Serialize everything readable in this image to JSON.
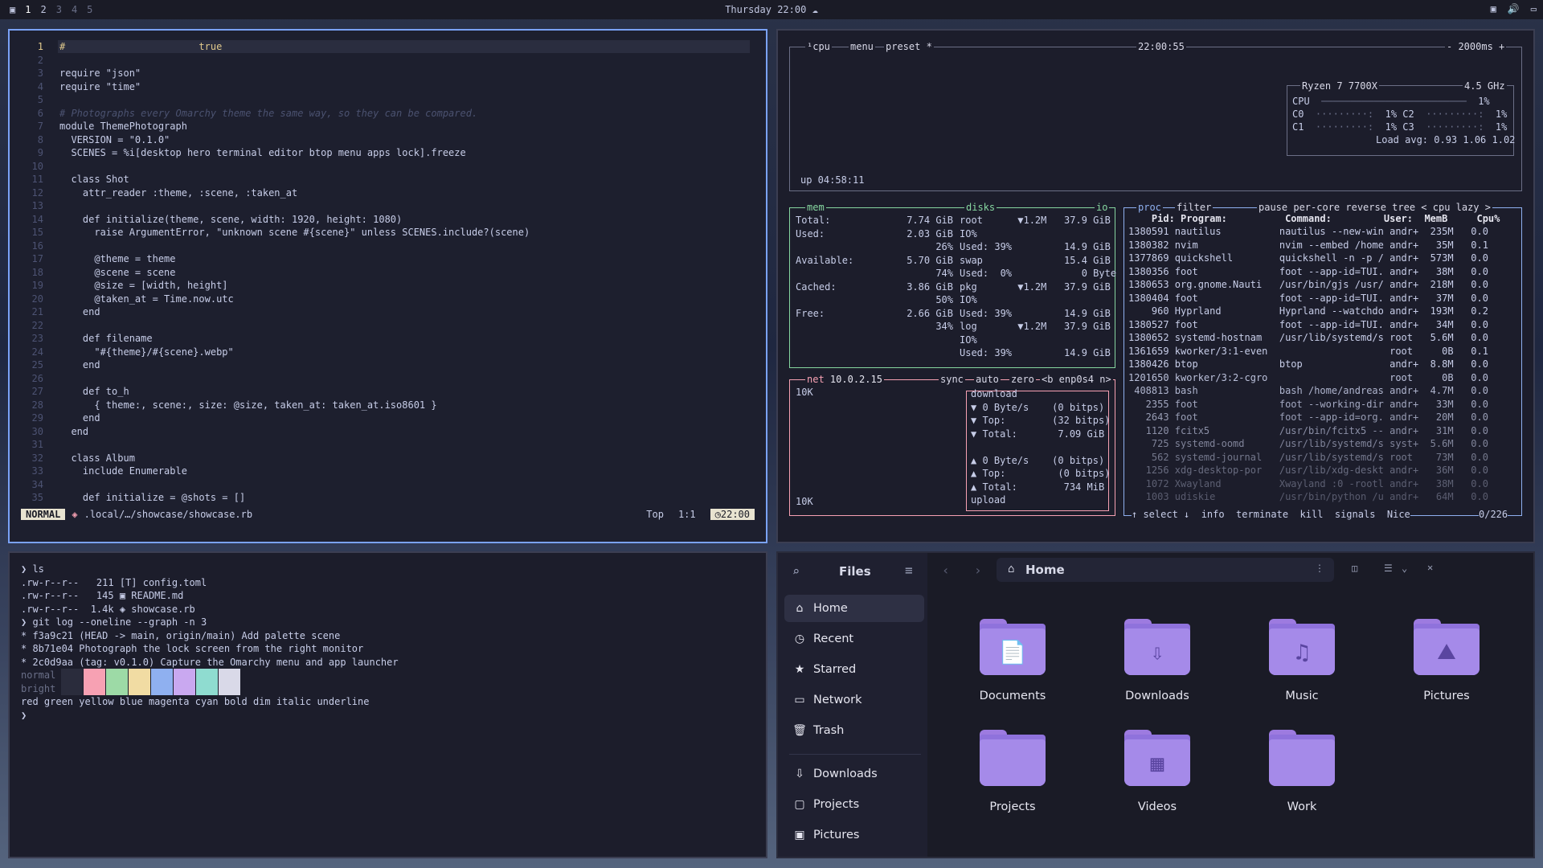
{
  "topbar": {
    "workspaces": [
      "1",
      "2",
      "3",
      "4",
      "5"
    ],
    "clock": "Thursday 22:00"
  },
  "nvim": {
    "lines": [
      {
        "n": "1",
        "t": "#                       true"
      },
      {
        "n": "2",
        "t": ""
      },
      {
        "n": "3",
        "t": "require \"json\""
      },
      {
        "n": "4",
        "t": "require \"time\""
      },
      {
        "n": "5",
        "t": ""
      },
      {
        "n": "6",
        "t": "# Photographs every Omarchy theme the same way, so they can be compared."
      },
      {
        "n": "7",
        "t": "module ThemePhotograph"
      },
      {
        "n": "8",
        "t": "  VERSION = \"0.1.0\""
      },
      {
        "n": "9",
        "t": "  SCENES = %i[desktop hero terminal editor btop menu apps lock].freeze"
      },
      {
        "n": "10",
        "t": ""
      },
      {
        "n": "11",
        "t": "  class Shot"
      },
      {
        "n": "12",
        "t": "    attr_reader :theme, :scene, :taken_at"
      },
      {
        "n": "13",
        "t": ""
      },
      {
        "n": "14",
        "t": "    def initialize(theme, scene, width: 1920, height: 1080)"
      },
      {
        "n": "15",
        "t": "      raise ArgumentError, \"unknown scene #{scene}\" unless SCENES.include?(scene)"
      },
      {
        "n": "16",
        "t": ""
      },
      {
        "n": "17",
        "t": "      @theme = theme"
      },
      {
        "n": "18",
        "t": "      @scene = scene"
      },
      {
        "n": "19",
        "t": "      @size = [width, height]"
      },
      {
        "n": "20",
        "t": "      @taken_at = Time.now.utc"
      },
      {
        "n": "21",
        "t": "    end"
      },
      {
        "n": "22",
        "t": ""
      },
      {
        "n": "23",
        "t": "    def filename"
      },
      {
        "n": "24",
        "t": "      \"#{theme}/#{scene}.webp\""
      },
      {
        "n": "25",
        "t": "    end"
      },
      {
        "n": "26",
        "t": ""
      },
      {
        "n": "27",
        "t": "    def to_h"
      },
      {
        "n": "28",
        "t": "      { theme:, scene:, size: @size, taken_at: taken_at.iso8601 }"
      },
      {
        "n": "29",
        "t": "    end"
      },
      {
        "n": "30",
        "t": "  end"
      },
      {
        "n": "31",
        "t": ""
      },
      {
        "n": "32",
        "t": "  class Album"
      },
      {
        "n": "33",
        "t": "    include Enumerable"
      },
      {
        "n": "34",
        "t": ""
      },
      {
        "n": "35",
        "t": "    def initialize = @shots = []"
      }
    ],
    "mode": "NORMAL",
    "file": ".local/…/showcase/showcase.rb",
    "scroll": "Top",
    "cursor": "1:1",
    "time": "22:00"
  },
  "btop": {
    "cpu_header": {
      "num": "¹",
      "label": "cpu",
      "menu": "menu",
      "preset": "preset *",
      "clock": "22:00:55",
      "interval": "- 2000ms +"
    },
    "cpu_model": "Ryzen 7 7700X",
    "cpu_freq": "4.5 GHz",
    "cpu_rows": [
      {
        "a": "CPU",
        "b": "1%"
      },
      {
        "a": "C0",
        "b": "1%",
        "c": "C2",
        "d": "1%"
      },
      {
        "a": "C1",
        "b": "1%",
        "c": "C3",
        "d": "1%"
      }
    ],
    "load": "Load avg: 0.93 1.06 1.02",
    "uptime": "up 04:58:11",
    "mem": {
      "title": "mem",
      "rows": [
        {
          "l": "Total:",
          "v": "7.74 GiB"
        },
        {
          "l": "Used:",
          "v": "2.03 GiB"
        },
        {
          "l": "",
          "v": "26%"
        },
        {
          "l": "Available:",
          "v": "5.70 GiB"
        },
        {
          "l": "",
          "v": "74%"
        },
        {
          "l": "Cached:",
          "v": "3.86 GiB"
        },
        {
          "l": "",
          "v": "50%"
        },
        {
          "l": "Free:",
          "v": "2.66 GiB"
        },
        {
          "l": "",
          "v": "34%"
        }
      ]
    },
    "disks": {
      "title": "disks",
      "io": "io",
      "rows": [
        "root      ▼1.2M   37.9 GiB",
        "IO%",
        "Used: 39%         14.9 GiB",
        "swap              15.4 GiB",
        "Used:  0%            0 Byte",
        "pkg       ▼1.2M   37.9 GiB",
        "IO%",
        "Used: 39%         14.9 GiB",
        "log       ▼1.2M   37.9 GiB",
        "IO%",
        "Used: 39%         14.9 GiB"
      ]
    },
    "net": {
      "title": "net",
      "ip": "10.0.2.15",
      "sync": "sync",
      "auto": "auto",
      "zero": "zero",
      "iface": "<b enp0s4 n>",
      "scale_top": "10K",
      "scale_bot": "10K",
      "rows": [
        "download",
        "▼ 0 Byte/s    (0 bitps)",
        "▼ Top:        (32 bitps)",
        "▼ Total:       7.09 GiB",
        "",
        "▲ 0 Byte/s    (0 bitps)",
        "▲ Top:         (0 bitps)",
        "▲ Total:        734 MiB",
        "upload"
      ]
    },
    "proc": {
      "title": "proc",
      "filter": "filter",
      "opts": "pause per-core reverse tree < cpu lazy >",
      "header": "    Pid: Program:          Command:         User:  MemB     Cpu%",
      "rows": [
        "1380591 nautilus          nautilus --new-win andr+  235M   0.0",
        "1380382 nvim              nvim --embed /home andr+   35M   0.1",
        "1377869 quickshell        quickshell -n -p / andr+  573M   0.0",
        "1380356 foot              foot --app-id=TUI. andr+   38M   0.0",
        "1380653 org.gnome.Nauti   /usr/bin/gjs /usr/ andr+  218M   0.0",
        "1380404 foot              foot --app-id=TUI. andr+   37M   0.0",
        "    960 Hyprland          Hyprland --watchdo andr+  193M   0.2",
        "1380527 foot              foot --app-id=TUI. andr+   34M   0.0",
        "1380652 systemd-hostnam   /usr/lib/systemd/s root   5.6M   0.0",
        "1361659 kworker/3:1-even                     root     0B   0.1",
        "1380426 btop              btop               andr+  8.8M   0.0",
        "1201650 kworker/3:2-cgro                     root     0B   0.0",
        " 408813 bash              bash /home/andreas andr+  4.7M   0.0",
        "   2355 foot              foot --working-dir andr+   33M   0.0",
        "   2643 foot              foot --app-id=org. andr+   20M   0.0",
        "   1120 fcitx5            /usr/bin/fcitx5 -- andr+   31M   0.0",
        "    725 systemd-oomd      /usr/lib/systemd/s syst+  5.6M   0.0",
        "    562 systemd-journal   /usr/lib/systemd/s root    73M   0.0",
        "   1256 xdg-desktop-por   /usr/lib/xdg-deskt andr+   36M   0.0",
        "   1072 Xwayland          Xwayland :0 -rootl andr+   38M   0.0",
        "   1003 udiskie           /usr/bin/python /u andr+   64M   0.0"
      ],
      "footer": "↑ select ↓  info  terminate  kill  signals  Nice",
      "count": "0/226"
    }
  },
  "terminal": {
    "lines": [
      "❯ ls",
      ".rw-r--r--   211 [T] config.toml",
      ".rw-r--r--   145 ▣ README.md",
      ".rw-r--r--  1.4k ◈ showcase.rb",
      "❯ git log --oneline --graph -n 3",
      "* f3a9c21 (HEAD -> main, origin/main) Add palette scene",
      "* 8b71e04 Photograph the lock screen from the right monitor",
      "* 2c0d9aa (tag: v0.1.0) Capture the Omarchy menu and app launcher",
      "normal",
      "bright",
      "red green yellow blue magenta cyan bold dim italic underline",
      "❯"
    ],
    "palette": [
      "#2a2c3c",
      "#f7a1b3",
      "#9ddaa6",
      "#f1dca3",
      "#8fb0f0",
      "#c9a8f0",
      "#8fdcd0",
      "#d9d9e8"
    ]
  },
  "files": {
    "title": "Files",
    "location": "Home",
    "sidebar": [
      {
        "icon": "⌂",
        "label": "Home"
      },
      {
        "icon": "◷",
        "label": "Recent"
      },
      {
        "icon": "★",
        "label": "Starred"
      },
      {
        "icon": "▭",
        "label": "Network"
      },
      {
        "icon": "🗑",
        "label": "Trash"
      },
      {
        "icon": "⇩",
        "label": "Downloads"
      },
      {
        "icon": "▢",
        "label": "Projects"
      },
      {
        "icon": "▣",
        "label": "Pictures"
      }
    ],
    "folders": [
      {
        "icon": "📄",
        "label": "Documents"
      },
      {
        "icon": "⇩",
        "label": "Downloads"
      },
      {
        "icon": "♫",
        "label": "Music"
      },
      {
        "icon": "⛰",
        "label": "Pictures"
      },
      {
        "icon": "",
        "label": "Projects"
      },
      {
        "icon": "▦",
        "label": "Videos"
      },
      {
        "icon": "",
        "label": "Work"
      }
    ]
  }
}
